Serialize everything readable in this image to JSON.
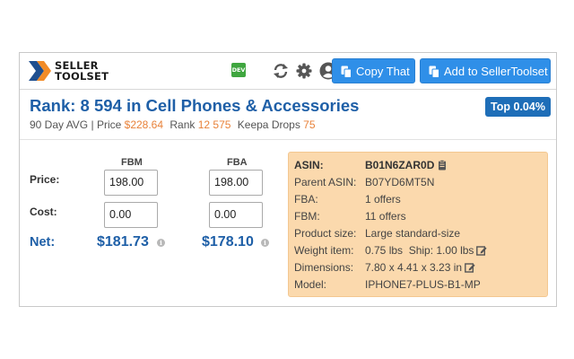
{
  "header": {
    "logo_line1": "SELLER",
    "logo_line2": "TOOLSET",
    "dev_badge": "DEV",
    "icons": [
      "dev-badge-icon",
      "refresh-icon",
      "gear-icon",
      "user-avatar-icon"
    ],
    "copy_button": "Copy That",
    "add_button": "Add to SellerToolset"
  },
  "rank": {
    "title": "Rank: 8 594 in Cell Phones & Accessories",
    "badge": "Top 0.04%",
    "avg_label": "90 Day AVG |",
    "price_label": "Price",
    "price_value": "$228.64",
    "rank_label": "Rank",
    "rank_value": "12 575",
    "drops_label": "Keepa Drops",
    "drops_value": "75"
  },
  "calculator": {
    "col_fbm": "FBM",
    "col_fba": "FBA",
    "price_label": "Price:",
    "cost_label": "Cost:",
    "net_label": "Net:",
    "fbm_price": "198.00",
    "fba_price": "198.00",
    "fbm_cost": "0.00",
    "fba_cost": "0.00",
    "fbm_net": "$181.73",
    "fba_net": "$178.10"
  },
  "details": [
    {
      "key": "ASIN:",
      "value": "B01N6ZAR0D"
    },
    {
      "key": "Parent ASIN:",
      "value": "B07YD6MT5N"
    },
    {
      "key": "FBA:",
      "value": "1 offers"
    },
    {
      "key": "FBM:",
      "value": "11 offers"
    },
    {
      "key": "Product size:",
      "value": "Large standard-size"
    },
    {
      "key": "Weight item:",
      "value": "0.75 lbs  Ship: 1.00 lbs"
    },
    {
      "key": "Dimensions:",
      "value": "7.80 x 4.41 x 3.23 in"
    },
    {
      "key": "Model:",
      "value": "IPHONE7-PLUS-B1-MP"
    }
  ],
  "colors": {
    "accent_blue": "#1e5fa7",
    "button_blue": "#2f8fe8",
    "orange": "#e8823a",
    "details_bg": "#fbd9ad"
  }
}
